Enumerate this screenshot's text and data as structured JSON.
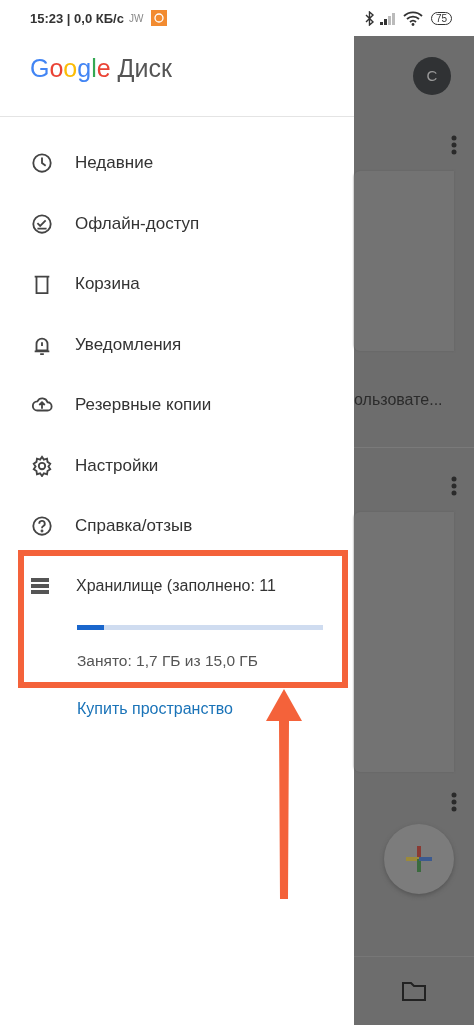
{
  "status_bar": {
    "clock": "15:23 | 0,0 КБ/с",
    "tag": "JW",
    "battery": "75"
  },
  "drawer": {
    "logo": {
      "brand": "Google",
      "product": "Диск"
    },
    "items": [
      {
        "kind": "clock",
        "label": "Недавние"
      },
      {
        "kind": "offline",
        "label": "Офлайн-доступ"
      },
      {
        "kind": "trash",
        "label": "Корзина"
      },
      {
        "kind": "bell",
        "label": "Уведомления"
      },
      {
        "kind": "backup",
        "label": "Резервные копии"
      },
      {
        "kind": "gear",
        "label": "Настройки"
      },
      {
        "kind": "help",
        "label": "Справка/отзыв"
      }
    ],
    "storage": {
      "label": "Хранилище (заполнено: 11",
      "level": 0.11,
      "usage": "Занято: 1,7 ГБ из 15,0 ГБ",
      "link": "Купить пространство"
    }
  },
  "background": {
    "avatar": "C",
    "truncated_text": "ользовате..."
  }
}
